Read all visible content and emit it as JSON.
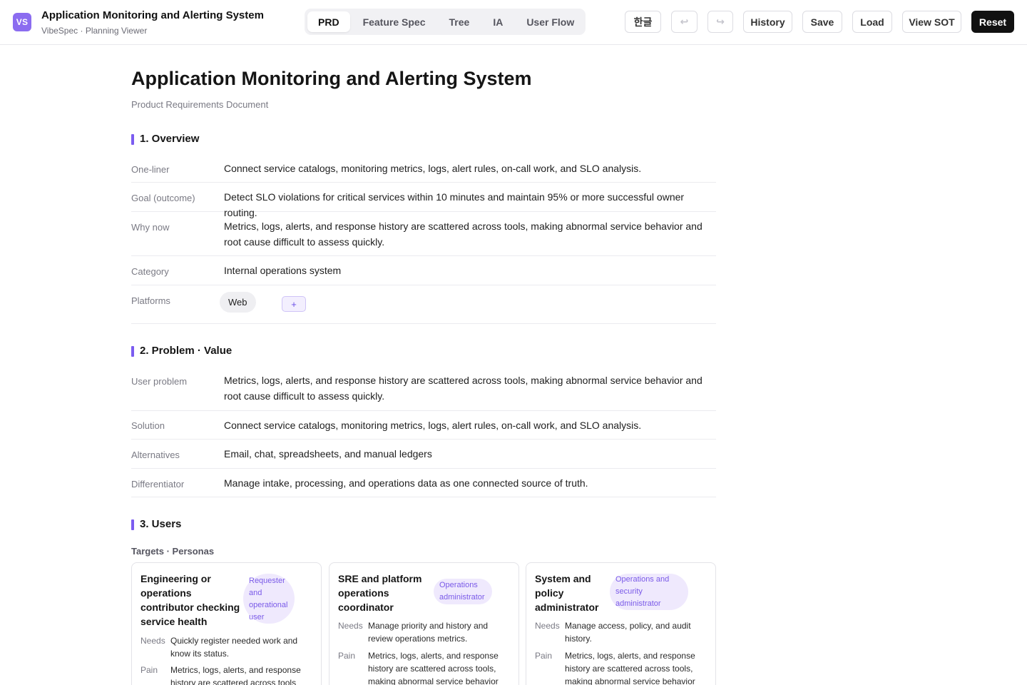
{
  "app": {
    "logo": "VS",
    "title": "Application Monitoring and Alerting System",
    "subtitle": "VibeSpec · Planning Viewer"
  },
  "tabs": [
    {
      "label": "PRD",
      "active": true
    },
    {
      "label": "Feature Spec",
      "active": false
    },
    {
      "label": "Tree",
      "active": false
    },
    {
      "label": "IA",
      "active": false
    },
    {
      "label": "User Flow",
      "active": false
    }
  ],
  "toolbar": {
    "lang": "한글",
    "undo": "↩",
    "redo": "↪",
    "history": "History",
    "save": "Save",
    "load": "Load",
    "view_sot": "View SOT",
    "reset": "Reset"
  },
  "doc": {
    "title": "Application Monitoring and Alerting System",
    "subtitle": "Product Requirements Document"
  },
  "overview": {
    "heading": "1. Overview",
    "rows": [
      {
        "label": "One-liner",
        "value": "Connect service catalogs, monitoring metrics, logs, alert rules, on-call work, and SLO analysis."
      },
      {
        "label": "Goal (outcome)",
        "value": "Detect SLO violations for critical services within 10 minutes and maintain 95% or more successful owner routing."
      },
      {
        "label": "Why now",
        "value": "Metrics, logs, alerts, and response history are scattered across tools, making abnormal service behavior and root cause difficult to assess quickly."
      },
      {
        "label": "Category",
        "value": "Internal operations system"
      },
      {
        "label": "Platforms",
        "chips": [
          "Web"
        ],
        "add": "+"
      }
    ]
  },
  "problem": {
    "heading": "2. Problem · Value",
    "rows": [
      {
        "label": "User problem",
        "value": "Metrics, logs, alerts, and response history are scattered across tools, making abnormal service behavior and root cause difficult to assess quickly."
      },
      {
        "label": "Solution",
        "value": "Connect service catalogs, monitoring metrics, logs, alert rules, on-call work, and SLO analysis."
      },
      {
        "label": "Alternatives",
        "value": "Email, chat, spreadsheets, and manual ledgers"
      },
      {
        "label": "Differentiator",
        "value": "Manage intake, processing, and operations data as one connected source of truth."
      }
    ]
  },
  "users": {
    "heading": "3. Users",
    "subheading": "Targets · Personas",
    "personas": [
      {
        "title": "Engineering or operations contributor checking service health",
        "badge": "Requester and operational user",
        "needs_label": "Needs",
        "needs": "Quickly register needed work and know its status.",
        "pain_label": "Pain",
        "pain": "Metrics, logs, alerts, and response history are scattered across tools"
      },
      {
        "title": "SRE and platform operations coordinator",
        "badge": "Operations administrator",
        "needs_label": "Needs",
        "needs": "Manage priority and history and review operations metrics.",
        "pain_label": "Pain",
        "pain": "Metrics, logs, alerts, and response history are scattered across tools, making abnormal service behavior"
      },
      {
        "title": "System and policy administrator",
        "badge": "Operations and security administrator",
        "needs_label": "Needs",
        "needs": "Manage access, policy, and audit history.",
        "pain_label": "Pain",
        "pain": "Metrics, logs, alerts, and response history are scattered across tools, making abnormal service behavior"
      }
    ]
  },
  "colors": {
    "accent": "#7b5cf0",
    "logo_bg": "#8b6cf0",
    "badge_bg": "#efe9fd",
    "dark_button": "#111111"
  }
}
